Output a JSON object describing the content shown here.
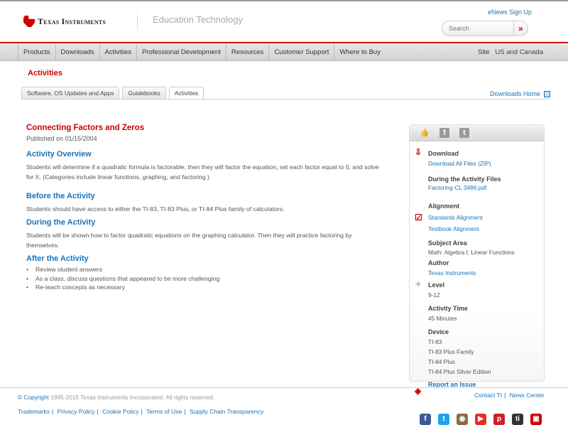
{
  "header": {
    "brand": "Texas Instruments",
    "section": "Education Technology",
    "enews": "eNews Sign Up",
    "search_placeholder": "Search",
    "search_go": "»"
  },
  "nav": {
    "items": [
      "Products",
      "Downloads",
      "Activities",
      "Professional Development",
      "Resources",
      "Customer Support",
      "Where to Buy"
    ],
    "site_label": "Site",
    "site_value": "US and Canada"
  },
  "page_title": "Activities",
  "tabs": [
    "Software, OS Updates and Apps",
    "Guidebooks",
    "Activities"
  ],
  "downloads_home": "Downloads Home",
  "main": {
    "title": "Connecting Factors and Zeros",
    "published": "Published on 01/15/2004",
    "sections": [
      {
        "heading": "Activity Overview",
        "text": "Students will determine if a quadratic formula is factorable, then they will factor the equation, set each factor equal to 0, and solve for X. (Categories include linear functions, graphing, and factoring.)"
      },
      {
        "heading": "Before the Activity",
        "text": "Students should have access to either the TI-83, TI-83 Plus, or TI-84 Plus family of calculators."
      },
      {
        "heading": "During the Activity",
        "text": "Students will be shown how to factor quadratic equations on the graphing calculator. Then they will practice factoring by themselves."
      }
    ],
    "after_heading": "After the Activity",
    "after_items": [
      "Review student answers",
      "As a class, discuss questions that appeared to be more challenging",
      "Re-teach concepts as necessary"
    ]
  },
  "sidebar": {
    "download_h": "Download",
    "download_all": "Download All Files (ZIP)",
    "during_h": "During the Activity Files",
    "during_file": "Factoring-CL 3486.pdf",
    "alignment_h": "Alignment",
    "standards": "Standards Alignment",
    "textbook": "Textbook Alignment",
    "subject_h": "Subject Area",
    "subject": "Math: Algebra I: Linear Functions",
    "author_h": "Author",
    "author": "Texas Instruments",
    "level_h": "Level",
    "level": "9-12",
    "time_h": "Activity Time",
    "time": "45 Minutes",
    "device_h": "Device",
    "devices": [
      "TI-83",
      "TI-83 Plus Family",
      "TI-84 Plus",
      "TI-84 Plus Silver Edition"
    ],
    "report": "Report an Issue"
  },
  "footer": {
    "copyright_label": "© Copyright",
    "copyright_text": "1995-2018 Texas Instruments Incorporated. All rights reserved.",
    "links": [
      "Trademarks",
      "Privacy Policy",
      "Cookie Policy",
      "Terms of Use",
      "Supply Chain Transparency"
    ],
    "right_links": [
      "Contact TI",
      "News Center"
    ],
    "social": [
      {
        "name": "facebook",
        "glyph": "f",
        "color": "#3b5998"
      },
      {
        "name": "twitter",
        "glyph": "t",
        "color": "#1da1f2"
      },
      {
        "name": "instagram",
        "glyph": "◉",
        "color": "#8a6a4a"
      },
      {
        "name": "youtube",
        "glyph": "▶",
        "color": "#e52d27"
      },
      {
        "name": "pinterest",
        "glyph": "p",
        "color": "#cb2027"
      },
      {
        "name": "ti-blog",
        "glyph": "ti",
        "color": "#333"
      },
      {
        "name": "ti-tube",
        "glyph": "▣",
        "color": "#c00"
      }
    ]
  },
  "colors": {
    "accent": "#cc0000",
    "link": "#1a73b8"
  }
}
